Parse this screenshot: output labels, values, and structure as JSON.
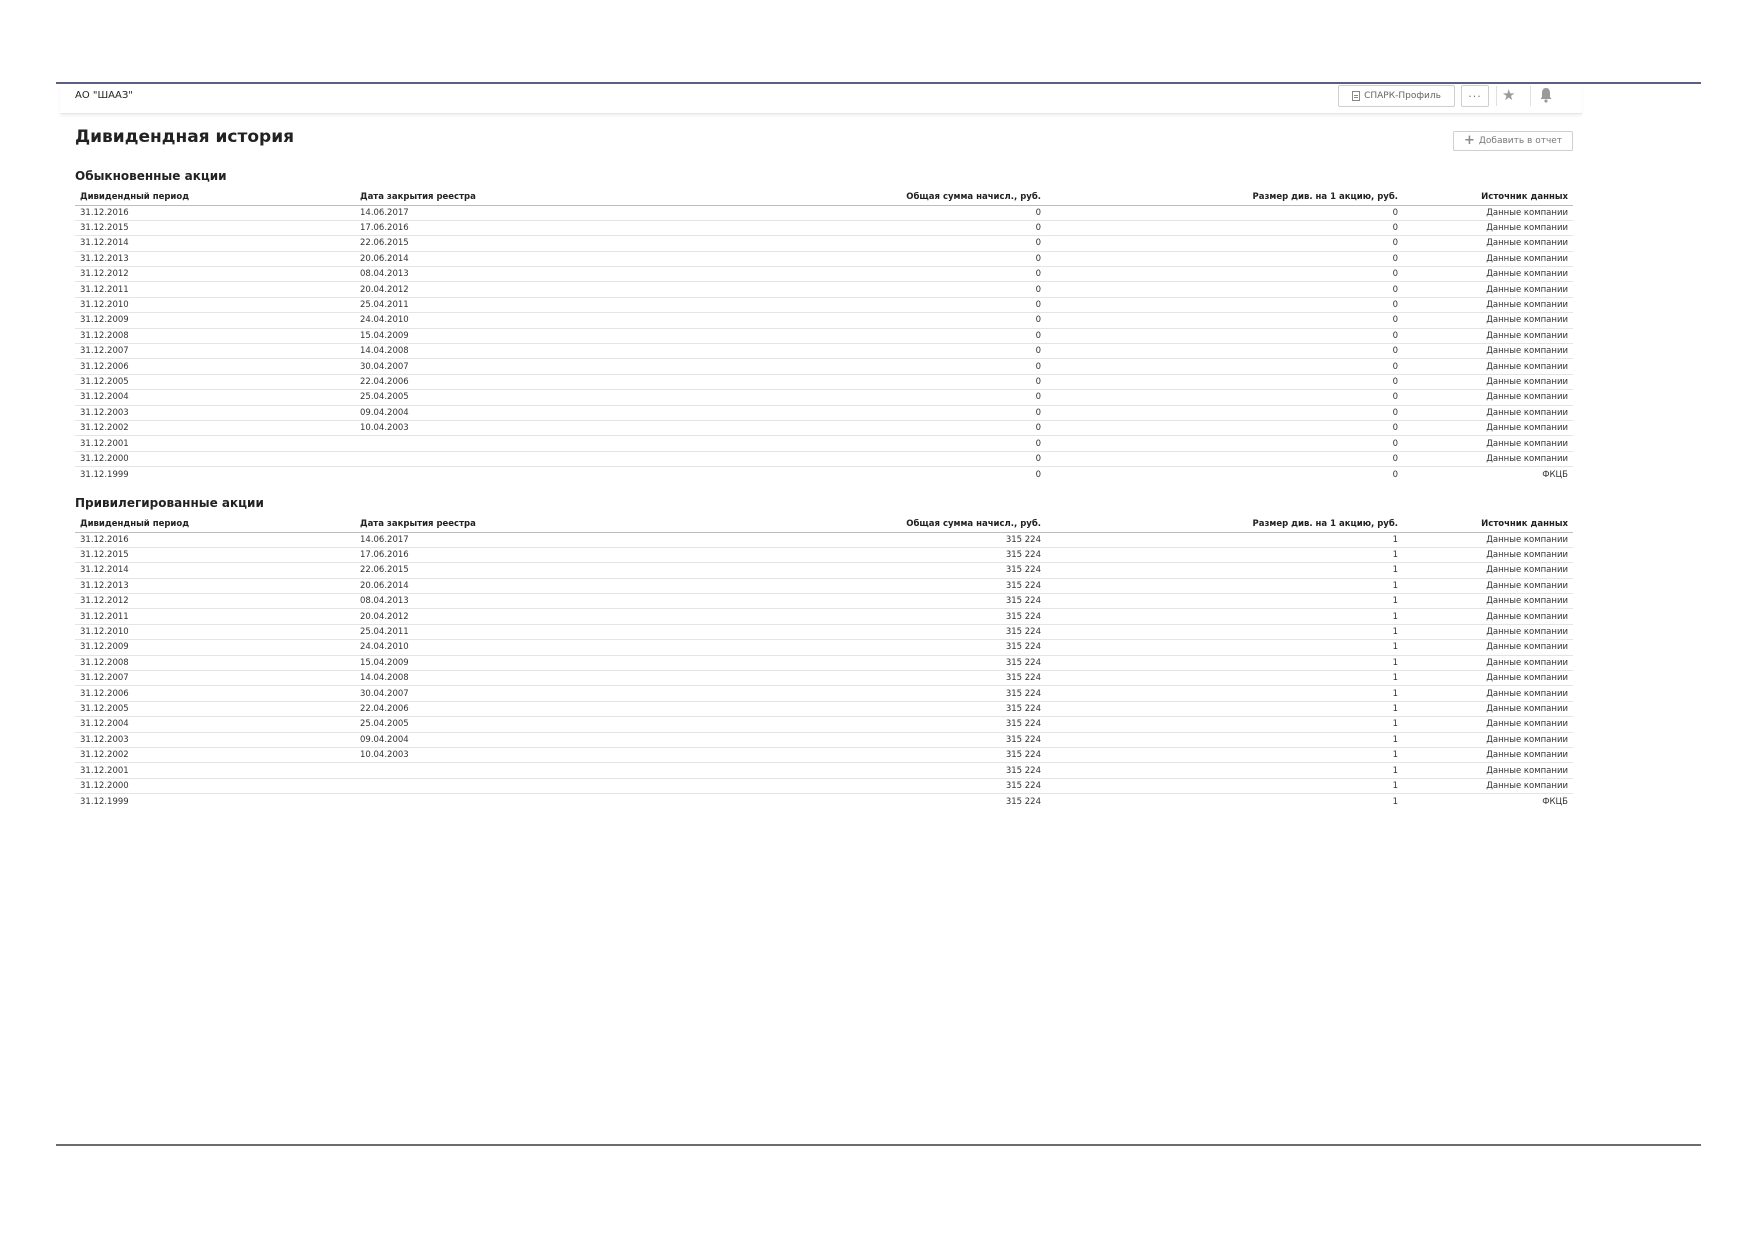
{
  "header": {
    "company": "АО \"ШААЗ\"",
    "spark_button": "СПАРК-Профиль",
    "more_button": "···"
  },
  "page": {
    "title": "Дивидендная история",
    "add_report_button": "Добавить в отчет"
  },
  "columns": {
    "period": "Дивидендный период",
    "close_date": "Дата закрытия реестра",
    "total": "Общая сумма начисл., руб.",
    "per_share": "Размер див. на 1 акцию, руб.",
    "source": "Источник данных"
  },
  "sections": [
    {
      "title": "Обыкновенные акции",
      "rows": [
        {
          "period": "31.12.2016",
          "close_date": "14.06.2017",
          "total": "0",
          "per_share": "0",
          "source": "Данные компании"
        },
        {
          "period": "31.12.2015",
          "close_date": "17.06.2016",
          "total": "0",
          "per_share": "0",
          "source": "Данные компании"
        },
        {
          "period": "31.12.2014",
          "close_date": "22.06.2015",
          "total": "0",
          "per_share": "0",
          "source": "Данные компании"
        },
        {
          "period": "31.12.2013",
          "close_date": "20.06.2014",
          "total": "0",
          "per_share": "0",
          "source": "Данные компании"
        },
        {
          "period": "31.12.2012",
          "close_date": "08.04.2013",
          "total": "0",
          "per_share": "0",
          "source": "Данные компании"
        },
        {
          "period": "31.12.2011",
          "close_date": "20.04.2012",
          "total": "0",
          "per_share": "0",
          "source": "Данные компании"
        },
        {
          "period": "31.12.2010",
          "close_date": "25.04.2011",
          "total": "0",
          "per_share": "0",
          "source": "Данные компании"
        },
        {
          "period": "31.12.2009",
          "close_date": "24.04.2010",
          "total": "0",
          "per_share": "0",
          "source": "Данные компании"
        },
        {
          "period": "31.12.2008",
          "close_date": "15.04.2009",
          "total": "0",
          "per_share": "0",
          "source": "Данные компании"
        },
        {
          "period": "31.12.2007",
          "close_date": "14.04.2008",
          "total": "0",
          "per_share": "0",
          "source": "Данные компании"
        },
        {
          "period": "31.12.2006",
          "close_date": "30.04.2007",
          "total": "0",
          "per_share": "0",
          "source": "Данные компании"
        },
        {
          "period": "31.12.2005",
          "close_date": "22.04.2006",
          "total": "0",
          "per_share": "0",
          "source": "Данные компании"
        },
        {
          "period": "31.12.2004",
          "close_date": "25.04.2005",
          "total": "0",
          "per_share": "0",
          "source": "Данные компании"
        },
        {
          "period": "31.12.2003",
          "close_date": "09.04.2004",
          "total": "0",
          "per_share": "0",
          "source": "Данные компании"
        },
        {
          "period": "31.12.2002",
          "close_date": "10.04.2003",
          "total": "0",
          "per_share": "0",
          "source": "Данные компании"
        },
        {
          "period": "31.12.2001",
          "close_date": "",
          "total": "0",
          "per_share": "0",
          "source": "Данные компании"
        },
        {
          "period": "31.12.2000",
          "close_date": "",
          "total": "0",
          "per_share": "0",
          "source": "Данные компании"
        },
        {
          "period": "31.12.1999",
          "close_date": "",
          "total": "0",
          "per_share": "0",
          "source": "ФКЦБ"
        }
      ]
    },
    {
      "title": "Привилегированные акции",
      "rows": [
        {
          "period": "31.12.2016",
          "close_date": "14.06.2017",
          "total": "315 224",
          "per_share": "1",
          "source": "Данные компании"
        },
        {
          "period": "31.12.2015",
          "close_date": "17.06.2016",
          "total": "315 224",
          "per_share": "1",
          "source": "Данные компании"
        },
        {
          "period": "31.12.2014",
          "close_date": "22.06.2015",
          "total": "315 224",
          "per_share": "1",
          "source": "Данные компании"
        },
        {
          "period": "31.12.2013",
          "close_date": "20.06.2014",
          "total": "315 224",
          "per_share": "1",
          "source": "Данные компании"
        },
        {
          "period": "31.12.2012",
          "close_date": "08.04.2013",
          "total": "315 224",
          "per_share": "1",
          "source": "Данные компании"
        },
        {
          "period": "31.12.2011",
          "close_date": "20.04.2012",
          "total": "315 224",
          "per_share": "1",
          "source": "Данные компании"
        },
        {
          "period": "31.12.2010",
          "close_date": "25.04.2011",
          "total": "315 224",
          "per_share": "1",
          "source": "Данные компании"
        },
        {
          "period": "31.12.2009",
          "close_date": "24.04.2010",
          "total": "315 224",
          "per_share": "1",
          "source": "Данные компании"
        },
        {
          "period": "31.12.2008",
          "close_date": "15.04.2009",
          "total": "315 224",
          "per_share": "1",
          "source": "Данные компании"
        },
        {
          "period": "31.12.2007",
          "close_date": "14.04.2008",
          "total": "315 224",
          "per_share": "1",
          "source": "Данные компании"
        },
        {
          "period": "31.12.2006",
          "close_date": "30.04.2007",
          "total": "315 224",
          "per_share": "1",
          "source": "Данные компании"
        },
        {
          "period": "31.12.2005",
          "close_date": "22.04.2006",
          "total": "315 224",
          "per_share": "1",
          "source": "Данные компании"
        },
        {
          "period": "31.12.2004",
          "close_date": "25.04.2005",
          "total": "315 224",
          "per_share": "1",
          "source": "Данные компании"
        },
        {
          "period": "31.12.2003",
          "close_date": "09.04.2004",
          "total": "315 224",
          "per_share": "1",
          "source": "Данные компании"
        },
        {
          "period": "31.12.2002",
          "close_date": "10.04.2003",
          "total": "315 224",
          "per_share": "1",
          "source": "Данные компании"
        },
        {
          "period": "31.12.2001",
          "close_date": "",
          "total": "315 224",
          "per_share": "1",
          "source": "Данные компании"
        },
        {
          "period": "31.12.2000",
          "close_date": "",
          "total": "315 224",
          "per_share": "1",
          "source": "Данные компании"
        },
        {
          "period": "31.12.1999",
          "close_date": "",
          "total": "315 224",
          "per_share": "1",
          "source": "ФКЦБ"
        }
      ]
    }
  ]
}
